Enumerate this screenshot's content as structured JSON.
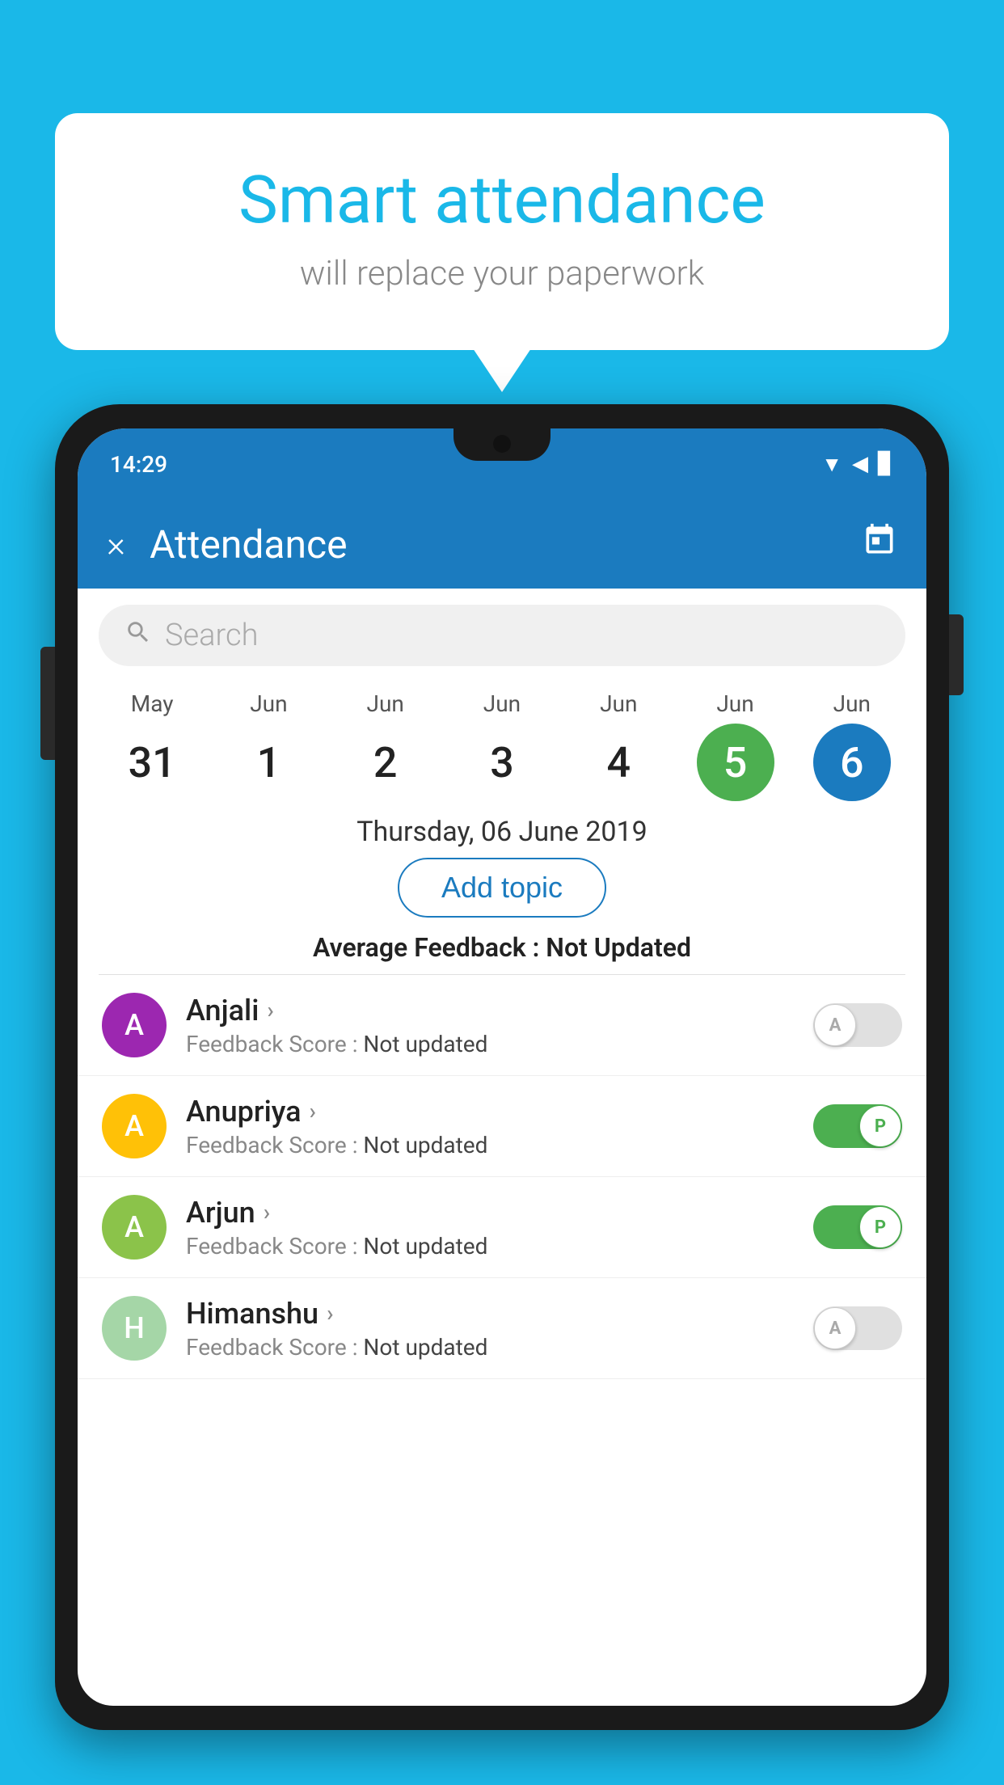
{
  "background_color": "#1ab8e8",
  "speech_bubble": {
    "title": "Smart attendance",
    "subtitle": "will replace your paperwork"
  },
  "status_bar": {
    "time": "14:29",
    "wifi": "▼",
    "signal": "▲",
    "battery": "▊"
  },
  "app_bar": {
    "title": "Attendance",
    "close_label": "×",
    "calendar_icon": "📅"
  },
  "search": {
    "placeholder": "Search"
  },
  "calendar": {
    "days": [
      {
        "month": "May",
        "date": "31",
        "type": "normal"
      },
      {
        "month": "Jun",
        "date": "1",
        "type": "normal"
      },
      {
        "month": "Jun",
        "date": "2",
        "type": "normal"
      },
      {
        "month": "Jun",
        "date": "3",
        "type": "normal"
      },
      {
        "month": "Jun",
        "date": "4",
        "type": "normal"
      },
      {
        "month": "Jun",
        "date": "5",
        "type": "today"
      },
      {
        "month": "Jun",
        "date": "6",
        "type": "selected"
      }
    ]
  },
  "selected_date": "Thursday, 06 June 2019",
  "add_topic_label": "Add topic",
  "avg_feedback_label": "Average Feedback :",
  "avg_feedback_value": "Not Updated",
  "students": [
    {
      "name": "Anjali",
      "initial": "A",
      "avatar_color": "#9c27b0",
      "feedback_label": "Feedback Score :",
      "feedback_value": "Not updated",
      "attendance": "absent",
      "toggle_letter": "A"
    },
    {
      "name": "Anupriya",
      "initial": "A",
      "avatar_color": "#ffc107",
      "feedback_label": "Feedback Score :",
      "feedback_value": "Not updated",
      "attendance": "present",
      "toggle_letter": "P"
    },
    {
      "name": "Arjun",
      "initial": "A",
      "avatar_color": "#8bc34a",
      "feedback_label": "Feedback Score :",
      "feedback_value": "Not updated",
      "attendance": "present",
      "toggle_letter": "P"
    },
    {
      "name": "Himanshu",
      "initial": "H",
      "avatar_color": "#a5d6a7",
      "feedback_label": "Feedback Score :",
      "feedback_value": "Not updated",
      "attendance": "absent",
      "toggle_letter": "A"
    }
  ]
}
